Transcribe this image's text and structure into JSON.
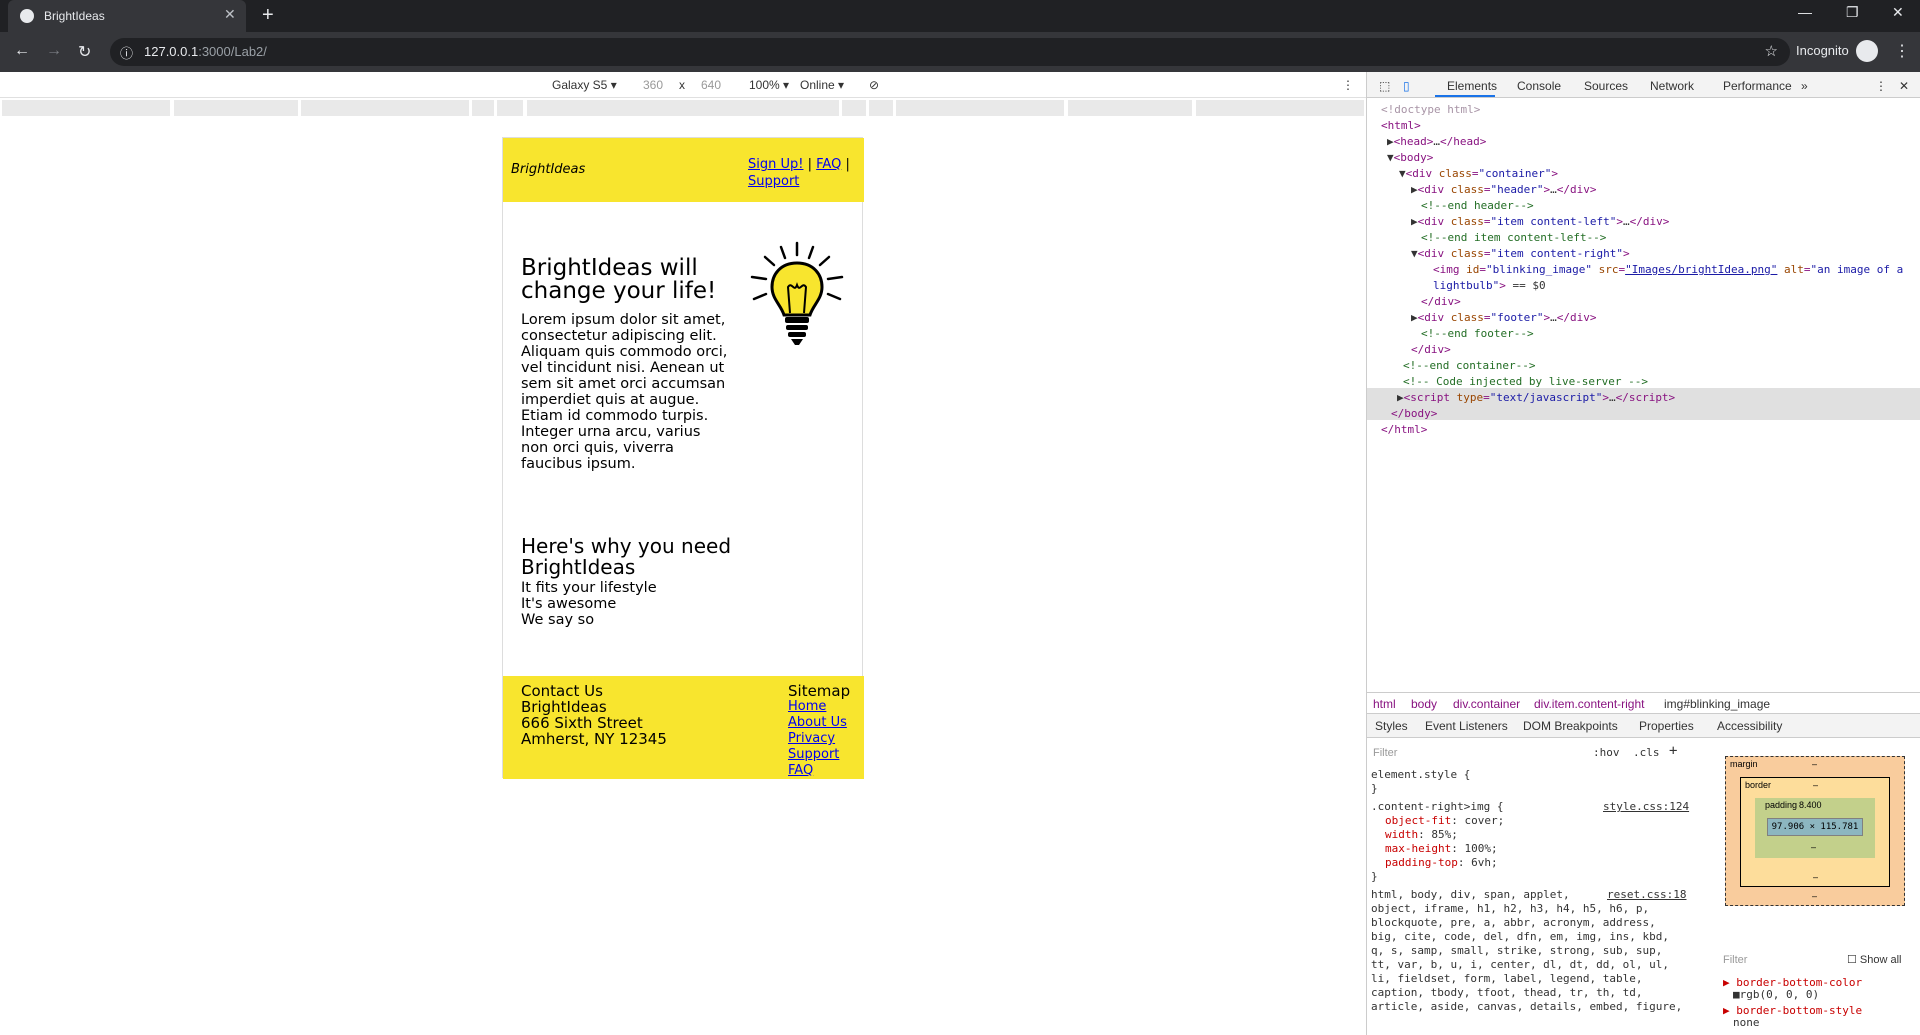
{
  "browser": {
    "tab_title": "BrightIdeas",
    "url_host": "127.0.0.1",
    "url_path": ":3000/Lab2/",
    "incognito_label": "Incognito"
  },
  "device_toolbar": {
    "device": "Galaxy S5",
    "width": "360",
    "times": "x",
    "height": "640",
    "zoom": "100%",
    "network": "Online"
  },
  "page": {
    "brand": "BrightIdeas",
    "nav": [
      "Sign Up!",
      "FAQ",
      "Support"
    ],
    "heading": "BrightIdeas will change your life!",
    "lorem": "Lorem ipsum dolor sit amet, consectetur adipiscing elit. Aliquam quis commodo orci, vel tincidunt nisi. Aenean ut sem sit amet orci accumsan imperdiet quis at augue. Etiam id commodo turpis. Integer urna arcu, varius non orci quis, viverra faucibus ipsum.",
    "why_heading": "Here's why you need BrightIdeas",
    "why_lines": [
      "It fits your lifestyle",
      "It's awesome",
      "We say so"
    ],
    "contact": {
      "title": "Contact Us",
      "lines": [
        "BrightIdeas",
        "666 Sixth Street",
        "Amherst, NY 12345"
      ]
    },
    "sitemap": {
      "title": "Sitemap",
      "links": [
        "Home",
        "About Us",
        "Privacy",
        "Support",
        "FAQ"
      ]
    },
    "bulb_alt": "an image of a lightbulb"
  },
  "devtools": {
    "tabs": [
      "Elements",
      "Console",
      "Sources",
      "Network",
      "Performance"
    ],
    "breadcrumbs": [
      "html",
      "body",
      "div.container",
      "div.item.content-right",
      "img#blinking_image"
    ],
    "subtabs": [
      "Styles",
      "Event Listeners",
      "DOM Breakpoints",
      "Properties",
      "Accessibility"
    ],
    "filter_placeholder": "Filter",
    "hov": ":hov",
    "cls": ".cls",
    "box_model": {
      "margin": "margin",
      "border": "border",
      "padding": "padding",
      "padding_value": "8.400",
      "content": "97.906 × 115.781",
      "dash": "–"
    },
    "computed_filter": "Filter",
    "show_all": "Show all"
  }
}
